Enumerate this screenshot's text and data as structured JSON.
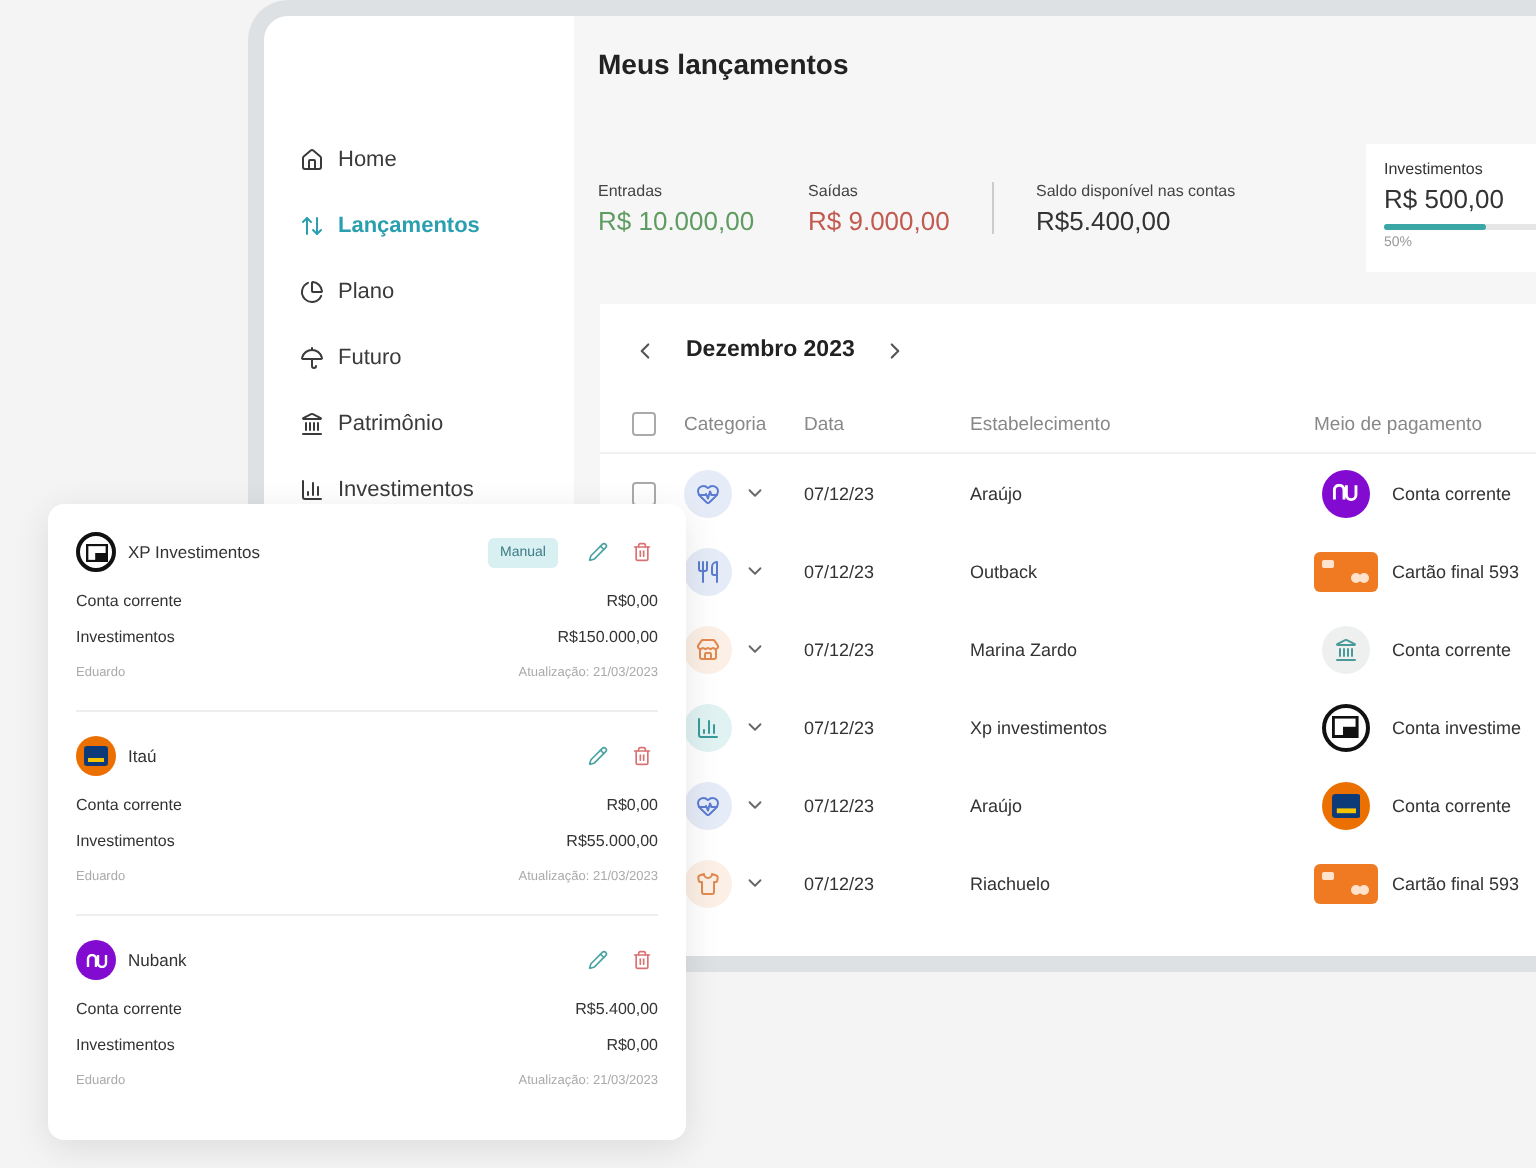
{
  "sidebar": {
    "items": [
      {
        "kind": "home",
        "label": "Home",
        "selected": false
      },
      {
        "kind": "transfers",
        "label": "Lançamentos",
        "selected": true
      },
      {
        "kind": "plan",
        "label": "Plano",
        "selected": false
      },
      {
        "kind": "future",
        "label": "Futuro",
        "selected": false
      },
      {
        "kind": "assets",
        "label": "Patrimônio",
        "selected": false
      },
      {
        "kind": "investments",
        "label": "Investimentos",
        "selected": false
      }
    ]
  },
  "header": {
    "title": "Meus lançamentos"
  },
  "summary": [
    {
      "kind": "income",
      "label": "Entradas",
      "value": "R$ 10.000,00"
    },
    {
      "kind": "expense",
      "label": "Saídas",
      "value": "R$ 9.000,00"
    },
    {
      "kind": "balance",
      "label": "Saldo disponível nas contas",
      "value": "R$5.400,00"
    }
  ],
  "goal": {
    "label": "Investimentos",
    "value": "R$ 500,00",
    "level": 0.5,
    "percent": "50%"
  },
  "transactions": {
    "month": "Dezembro 2023",
    "all_checked": false,
    "columns": [
      "Categoria",
      "Data",
      "Estabelecimento",
      "Meio de pagamento"
    ],
    "rows": [
      {
        "checked": false,
        "category": {
          "kind": "health"
        },
        "date": "07/12/23",
        "place": "Araújo",
        "payment": {
          "kind": "nubank",
          "text": "Conta corrente"
        }
      },
      {
        "category": {
          "kind": "food"
        },
        "date": "07/12/23",
        "place": "Outback",
        "payment": {
          "kind": "card",
          "text": "Cartão final 593"
        }
      },
      {
        "category": {
          "kind": "shopping"
        },
        "date": "07/12/23",
        "place": "Marina Zardo",
        "payment": {
          "kind": "bank",
          "text": "Conta corrente"
        }
      },
      {
        "category": {
          "kind": "invest"
        },
        "date": "07/12/23",
        "place": "Xp investimentos",
        "payment": {
          "kind": "xp",
          "text": "Conta investime"
        }
      },
      {
        "category": {
          "kind": "health"
        },
        "date": "07/12/23",
        "place": "Araújo",
        "payment": {
          "kind": "itau",
          "text": "Conta corrente"
        }
      },
      {
        "category": {
          "kind": "clothing"
        },
        "date": "07/12/23",
        "place": "Riachuelo",
        "payment": {
          "kind": "card",
          "text": "Cartão final 593"
        }
      }
    ]
  },
  "accounts": [
    {
      "kind": "xp",
      "name": "XP Investimentos",
      "badge": "Manual",
      "lines": [
        {
          "label": "Conta corrente",
          "value": "R$0,00"
        },
        {
          "label": "Investimentos",
          "value": "R$150.000,00"
        }
      ],
      "owner": "Eduardo",
      "updated": "Atualização: 21/03/2023"
    },
    {
      "kind": "itau",
      "name": "Itaú",
      "lines": [
        {
          "label": "Conta corrente",
          "value": "R$0,00"
        },
        {
          "label": "Investimentos",
          "value": "R$55.000,00"
        }
      ],
      "owner": "Eduardo",
      "updated": "Atualização: 21/03/2023"
    },
    {
      "kind": "nubank",
      "name": "Nubank",
      "lines": [
        {
          "label": "Conta corrente",
          "value": "R$5.400,00"
        },
        {
          "label": "Investimentos",
          "value": "R$0,00"
        }
      ],
      "owner": "Eduardo",
      "updated": "Atualização: 21/03/2023"
    }
  ]
}
